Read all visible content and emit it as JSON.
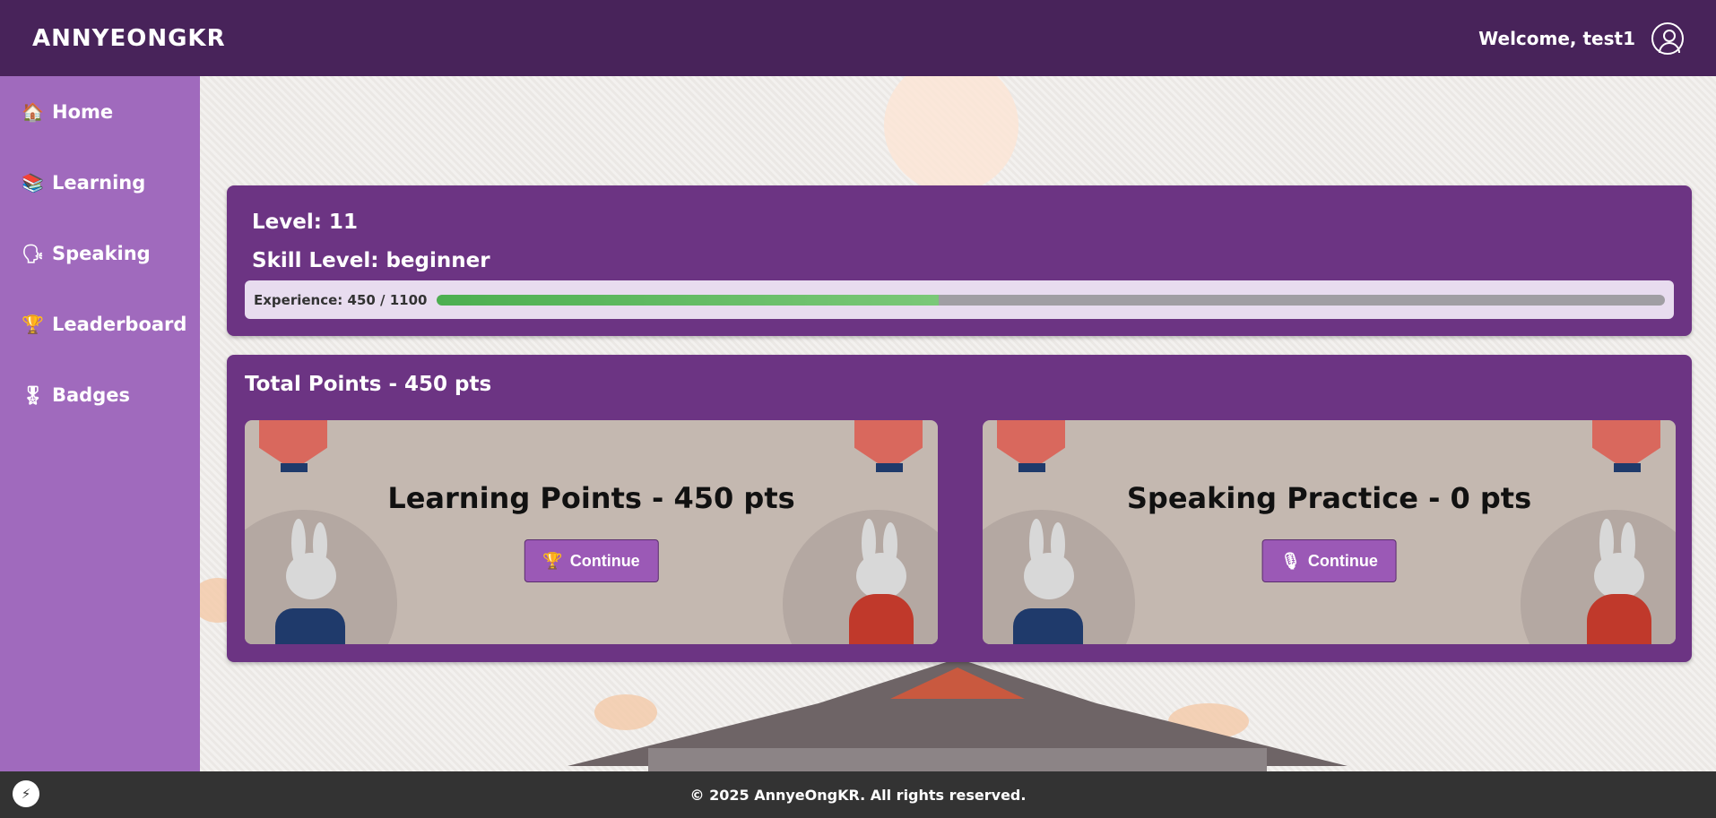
{
  "header": {
    "logo": "ANNYEONGKR",
    "welcome": "Welcome, test1"
  },
  "sidebar": {
    "items": [
      {
        "label": "Home",
        "icon": "house-icon",
        "glyph": "🏠"
      },
      {
        "label": "Learning",
        "icon": "books-icon",
        "glyph": "📚"
      },
      {
        "label": "Speaking",
        "icon": "speaking-head-icon",
        "glyph": "🗣"
      },
      {
        "label": "Leaderboard",
        "icon": "trophy-icon",
        "glyph": "🏆"
      },
      {
        "label": "Badges",
        "icon": "medal-icon",
        "glyph": "🎖"
      }
    ]
  },
  "level_panel": {
    "level": "Level: 11",
    "skill": "Skill Level: beginner",
    "xp_label": "Experience: 450 / 1100",
    "xp_current": 450,
    "xp_max": 1100
  },
  "points_panel": {
    "title": "Total Points - 450 pts",
    "cards": [
      {
        "title": "Learning Points - 450 pts",
        "button": "Continue",
        "icon": "trophy-icon",
        "glyph": "🏆"
      },
      {
        "title": "Speaking Practice - 0 pts",
        "button": "Continue",
        "icon": "microphone-icon",
        "glyph": "🎙"
      }
    ]
  },
  "footer": {
    "text": "© 2025 AnnyeOngKR. All rights reserved.",
    "bolt_icon": "⚡"
  },
  "colors": {
    "header": "#48235a",
    "sidebar": "#a06abd",
    "panel": "#6c3483",
    "button": "#9b59b6",
    "xp_fill": "#4caf50",
    "footer": "#333333"
  }
}
